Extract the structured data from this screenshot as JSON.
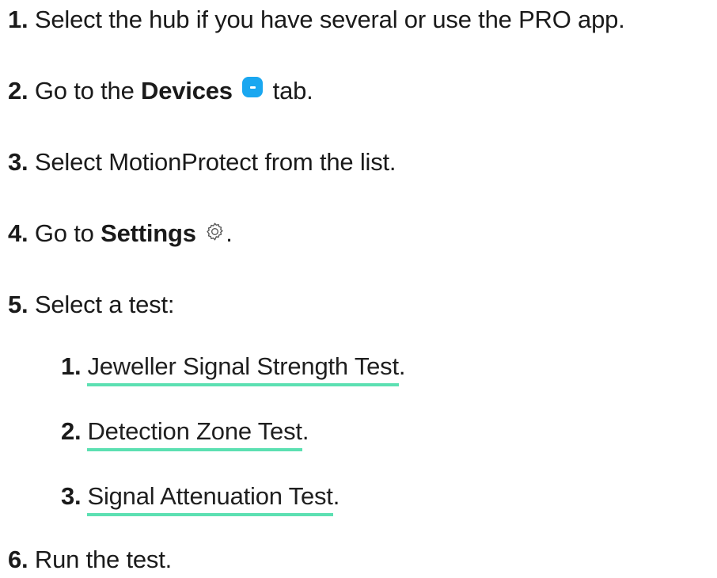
{
  "steps": [
    {
      "num": "1.",
      "text": "Select the hub if you have several or use the PRO app."
    },
    {
      "num": "2.",
      "prefix": "Go to the ",
      "bold": "Devices",
      "suffix": " tab.",
      "icon": "devices-tab-icon"
    },
    {
      "num": "3.",
      "text": "Select MotionProtect from the list."
    },
    {
      "num": "4.",
      "prefix": "Go to ",
      "bold": "Settings",
      "suffix": ".",
      "icon": "gear-icon"
    },
    {
      "num": "5.",
      "text": "Select a test:"
    },
    {
      "num": "6.",
      "text": "Run the test."
    }
  ],
  "tests": [
    {
      "num": "1.",
      "label": "Jeweller Signal Strength Test",
      "suffix": "."
    },
    {
      "num": "2.",
      "label": "Detection Zone Test",
      "suffix": "."
    },
    {
      "num": "3.",
      "label": "Signal Attenuation Test",
      "suffix": "."
    }
  ],
  "colors": {
    "text": "#1a1a1a",
    "link_underline": "#5ce0b2",
    "devices_icon": "#1aa7f0",
    "gear_icon": "#555555"
  }
}
